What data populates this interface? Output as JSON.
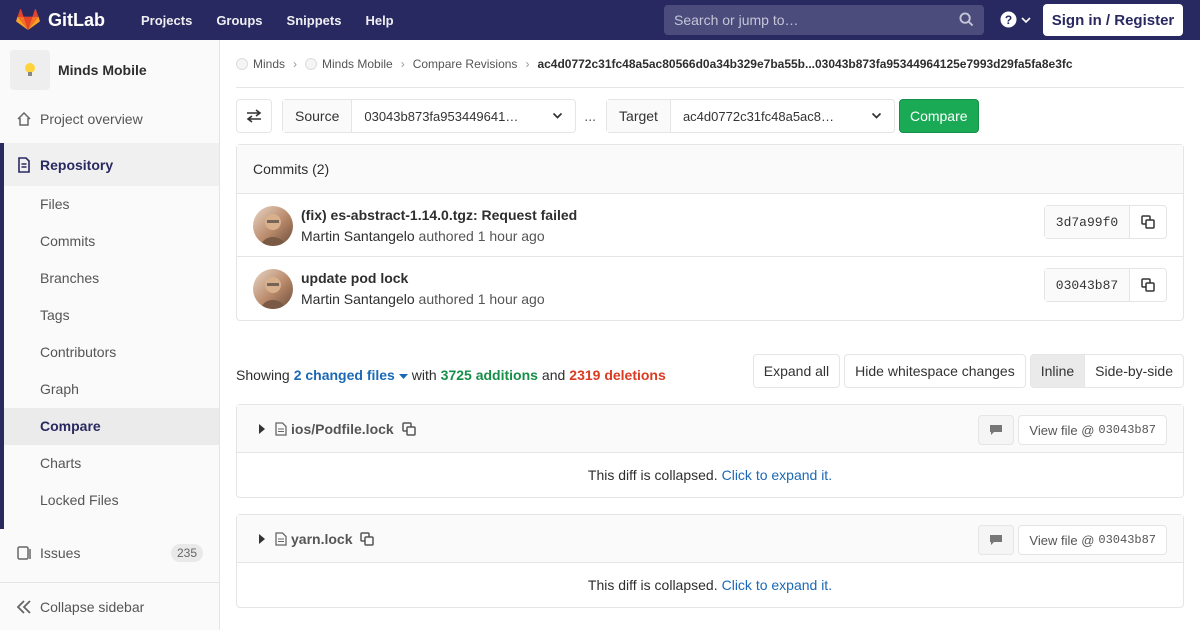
{
  "topnav": {
    "brand": "GitLab",
    "links": [
      "Projects",
      "Groups",
      "Snippets",
      "Help"
    ],
    "search_placeholder": "Search or jump to…",
    "signin": "Sign in / Register"
  },
  "sidebar": {
    "project": "Minds Mobile",
    "overview": "Project overview",
    "repository": "Repository",
    "items": [
      "Files",
      "Commits",
      "Branches",
      "Tags",
      "Contributors",
      "Graph",
      "Compare",
      "Charts",
      "Locked Files"
    ],
    "active": "Compare",
    "issues": "Issues",
    "issues_count": "235",
    "collapse": "Collapse sidebar"
  },
  "breadcrumb": {
    "items": [
      "Minds",
      "Minds Mobile",
      "Compare Revisions"
    ],
    "current": "ac4d0772c31fc48a5ac80566d0a34b329e7ba55b...03043b873fa95344964125e7993d29fa5fa8e3fc"
  },
  "compare": {
    "source_label": "Source",
    "source_value": "03043b873fa953449641…",
    "dots": "...",
    "target_label": "Target",
    "target_value": "ac4d0772c31fc48a5ac8…",
    "button": "Compare"
  },
  "commits": {
    "header": "Commits (2)",
    "rows": [
      {
        "title": "(fix) es-abstract-1.14.0.tgz: Request failed",
        "author": "Martin Santangelo",
        "meta": "authored 1 hour ago",
        "sha": "3d7a99f0"
      },
      {
        "title": "update pod lock",
        "author": "Martin Santangelo",
        "meta": "authored 1 hour ago",
        "sha": "03043b87"
      }
    ]
  },
  "summary": {
    "showing": "Showing",
    "changed": "2 changed files",
    "with": "with",
    "additions": "3725 additions",
    "and": "and",
    "deletions": "2319 deletions",
    "expand_all": "Expand all",
    "hide_ws": "Hide whitespace changes",
    "inline": "Inline",
    "side": "Side-by-side"
  },
  "files": [
    {
      "name": "ios/Podfile.lock",
      "view": "View file @",
      "sha": "03043b87",
      "collapsed": "This diff is collapsed.",
      "expand": "Click to expand it."
    },
    {
      "name": "yarn.lock",
      "view": "View file @",
      "sha": "03043b87",
      "collapsed": "This diff is collapsed.",
      "expand": "Click to expand it."
    }
  ]
}
